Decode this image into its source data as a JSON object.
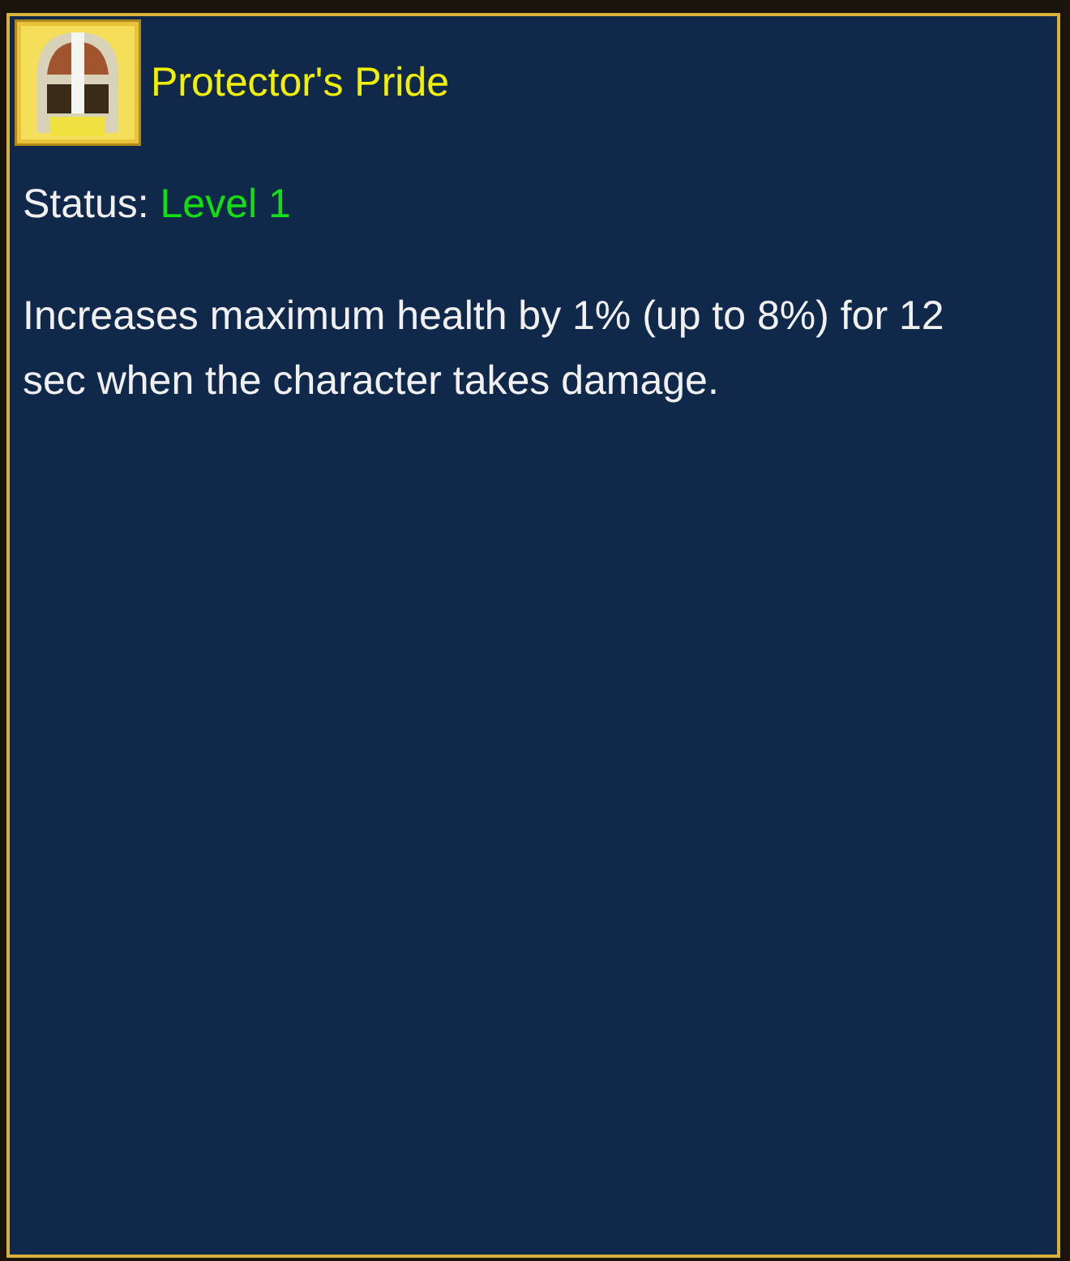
{
  "tooltip": {
    "title": "Protector's Pride",
    "status": {
      "label": "Status:",
      "value": "Level 1"
    },
    "description": "Increases maximum health by 1% (up to 8%) for 12 sec when the character takes damage."
  }
}
